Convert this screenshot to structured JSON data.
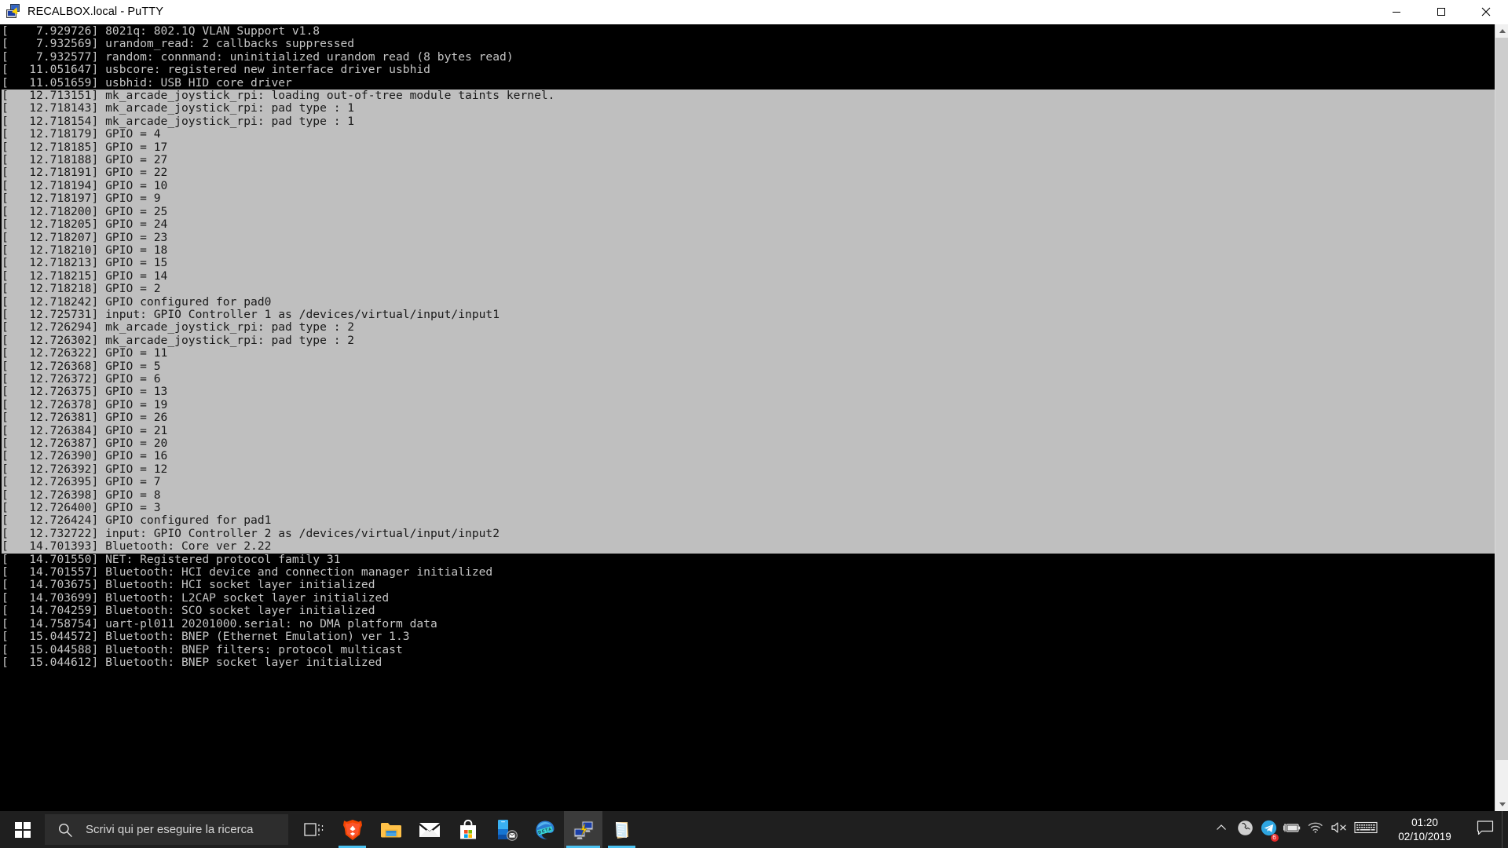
{
  "window": {
    "title": "RECALBOX.local - PuTTY",
    "icon": "putty-icon",
    "buttons": {
      "minimize": "Minimize",
      "maximize": "Maximize",
      "close": "Close"
    }
  },
  "terminal": {
    "selection": {
      "start_index": 5,
      "end_index": 40
    },
    "lines": [
      "[    7.929726] 8021q: 802.1Q VLAN Support v1.8",
      "[    7.932569] urandom_read: 2 callbacks suppressed",
      "[    7.932577] random: connmand: uninitialized urandom read (8 bytes read)",
      "[   11.051647] usbcore: registered new interface driver usbhid",
      "[   11.051659] usbhid: USB HID core driver",
      "[   12.713151] mk_arcade_joystick_rpi: loading out-of-tree module taints kernel.",
      "[   12.718143] mk_arcade_joystick_rpi: pad type : 1",
      "[   12.718154] mk_arcade_joystick_rpi: pad type : 1",
      "[   12.718179] GPIO = 4",
      "[   12.718185] GPIO = 17",
      "[   12.718188] GPIO = 27",
      "[   12.718191] GPIO = 22",
      "[   12.718194] GPIO = 10",
      "[   12.718197] GPIO = 9",
      "[   12.718200] GPIO = 25",
      "[   12.718205] GPIO = 24",
      "[   12.718207] GPIO = 23",
      "[   12.718210] GPIO = 18",
      "[   12.718213] GPIO = 15",
      "[   12.718215] GPIO = 14",
      "[   12.718218] GPIO = 2",
      "[   12.718242] GPIO configured for pad0",
      "[   12.725731] input: GPIO Controller 1 as /devices/virtual/input/input1",
      "[   12.726294] mk_arcade_joystick_rpi: pad type : 2",
      "[   12.726302] mk_arcade_joystick_rpi: pad type : 2",
      "[   12.726322] GPIO = 11",
      "[   12.726368] GPIO = 5",
      "[   12.726372] GPIO = 6",
      "[   12.726375] GPIO = 13",
      "[   12.726378] GPIO = 19",
      "[   12.726381] GPIO = 26",
      "[   12.726384] GPIO = 21",
      "[   12.726387] GPIO = 20",
      "[   12.726390] GPIO = 16",
      "[   12.726392] GPIO = 12",
      "[   12.726395] GPIO = 7",
      "[   12.726398] GPIO = 8",
      "[   12.726400] GPIO = 3",
      "[   12.726424] GPIO configured for pad1",
      "[   12.732722] input: GPIO Controller 2 as /devices/virtual/input/input2",
      "[   14.701393] Bluetooth: Core ver 2.22",
      "[   14.701550] NET: Registered protocol family 31",
      "[   14.701557] Bluetooth: HCI device and connection manager initialized",
      "[   14.703675] Bluetooth: HCI socket layer initialized",
      "[   14.703699] Bluetooth: L2CAP socket layer initialized",
      "[   14.704259] Bluetooth: SCO socket layer initialized",
      "[   14.758754] uart-pl011 20201000.serial: no DMA platform data",
      "[   15.044572] Bluetooth: BNEP (Ethernet Emulation) ver 1.3",
      "[   15.044588] Bluetooth: BNEP filters: protocol multicast",
      "[   15.044612] Bluetooth: BNEP socket layer initialized"
    ]
  },
  "taskbar": {
    "start_label": "Start",
    "search": {
      "placeholder": "Scrivi qui per eseguire la ricerca",
      "icon": "search-icon"
    },
    "apps": [
      {
        "name": "task-view",
        "label": "Task View",
        "state": "idle"
      },
      {
        "name": "brave",
        "label": "Brave",
        "state": "running"
      },
      {
        "name": "file-explorer",
        "label": "Esplora file",
        "state": "idle"
      },
      {
        "name": "mail",
        "label": "Posta",
        "state": "idle"
      },
      {
        "name": "microsoft-store",
        "label": "Microsoft Store",
        "state": "idle"
      },
      {
        "name": "your-phone",
        "label": "Your Phone",
        "state": "idle"
      },
      {
        "name": "edge-beta",
        "label": "Microsoft Edge Beta",
        "state": "idle"
      },
      {
        "name": "putty",
        "label": "PuTTY",
        "state": "active"
      },
      {
        "name": "notepad",
        "label": "Blocco note",
        "state": "running"
      }
    ],
    "tray": [
      {
        "name": "show-hidden-icons",
        "label": "Mostra icone nascoste"
      },
      {
        "name": "skype",
        "label": "Skype"
      },
      {
        "name": "telegram",
        "label": "Telegram",
        "badge": "6"
      },
      {
        "name": "battery",
        "label": "Batteria in carica"
      },
      {
        "name": "wifi",
        "label": "Rete wireless"
      },
      {
        "name": "volume-muted",
        "label": "Volume disattivato"
      },
      {
        "name": "touch-keyboard",
        "label": "Tastiera virtuale"
      }
    ],
    "clock": {
      "time": "01:20",
      "date": "02/10/2019"
    },
    "action_center": "Centro notifiche"
  },
  "colors": {
    "terminal_bg": "#000000",
    "terminal_fg": "#c5c5c5",
    "selection_bg": "#bfbfbf",
    "selection_fg": "#1a1a1a",
    "titlebar_bg": "#ffffff",
    "taskbar_bg": "#1f1f1f",
    "accent": "#4cc2f1"
  }
}
